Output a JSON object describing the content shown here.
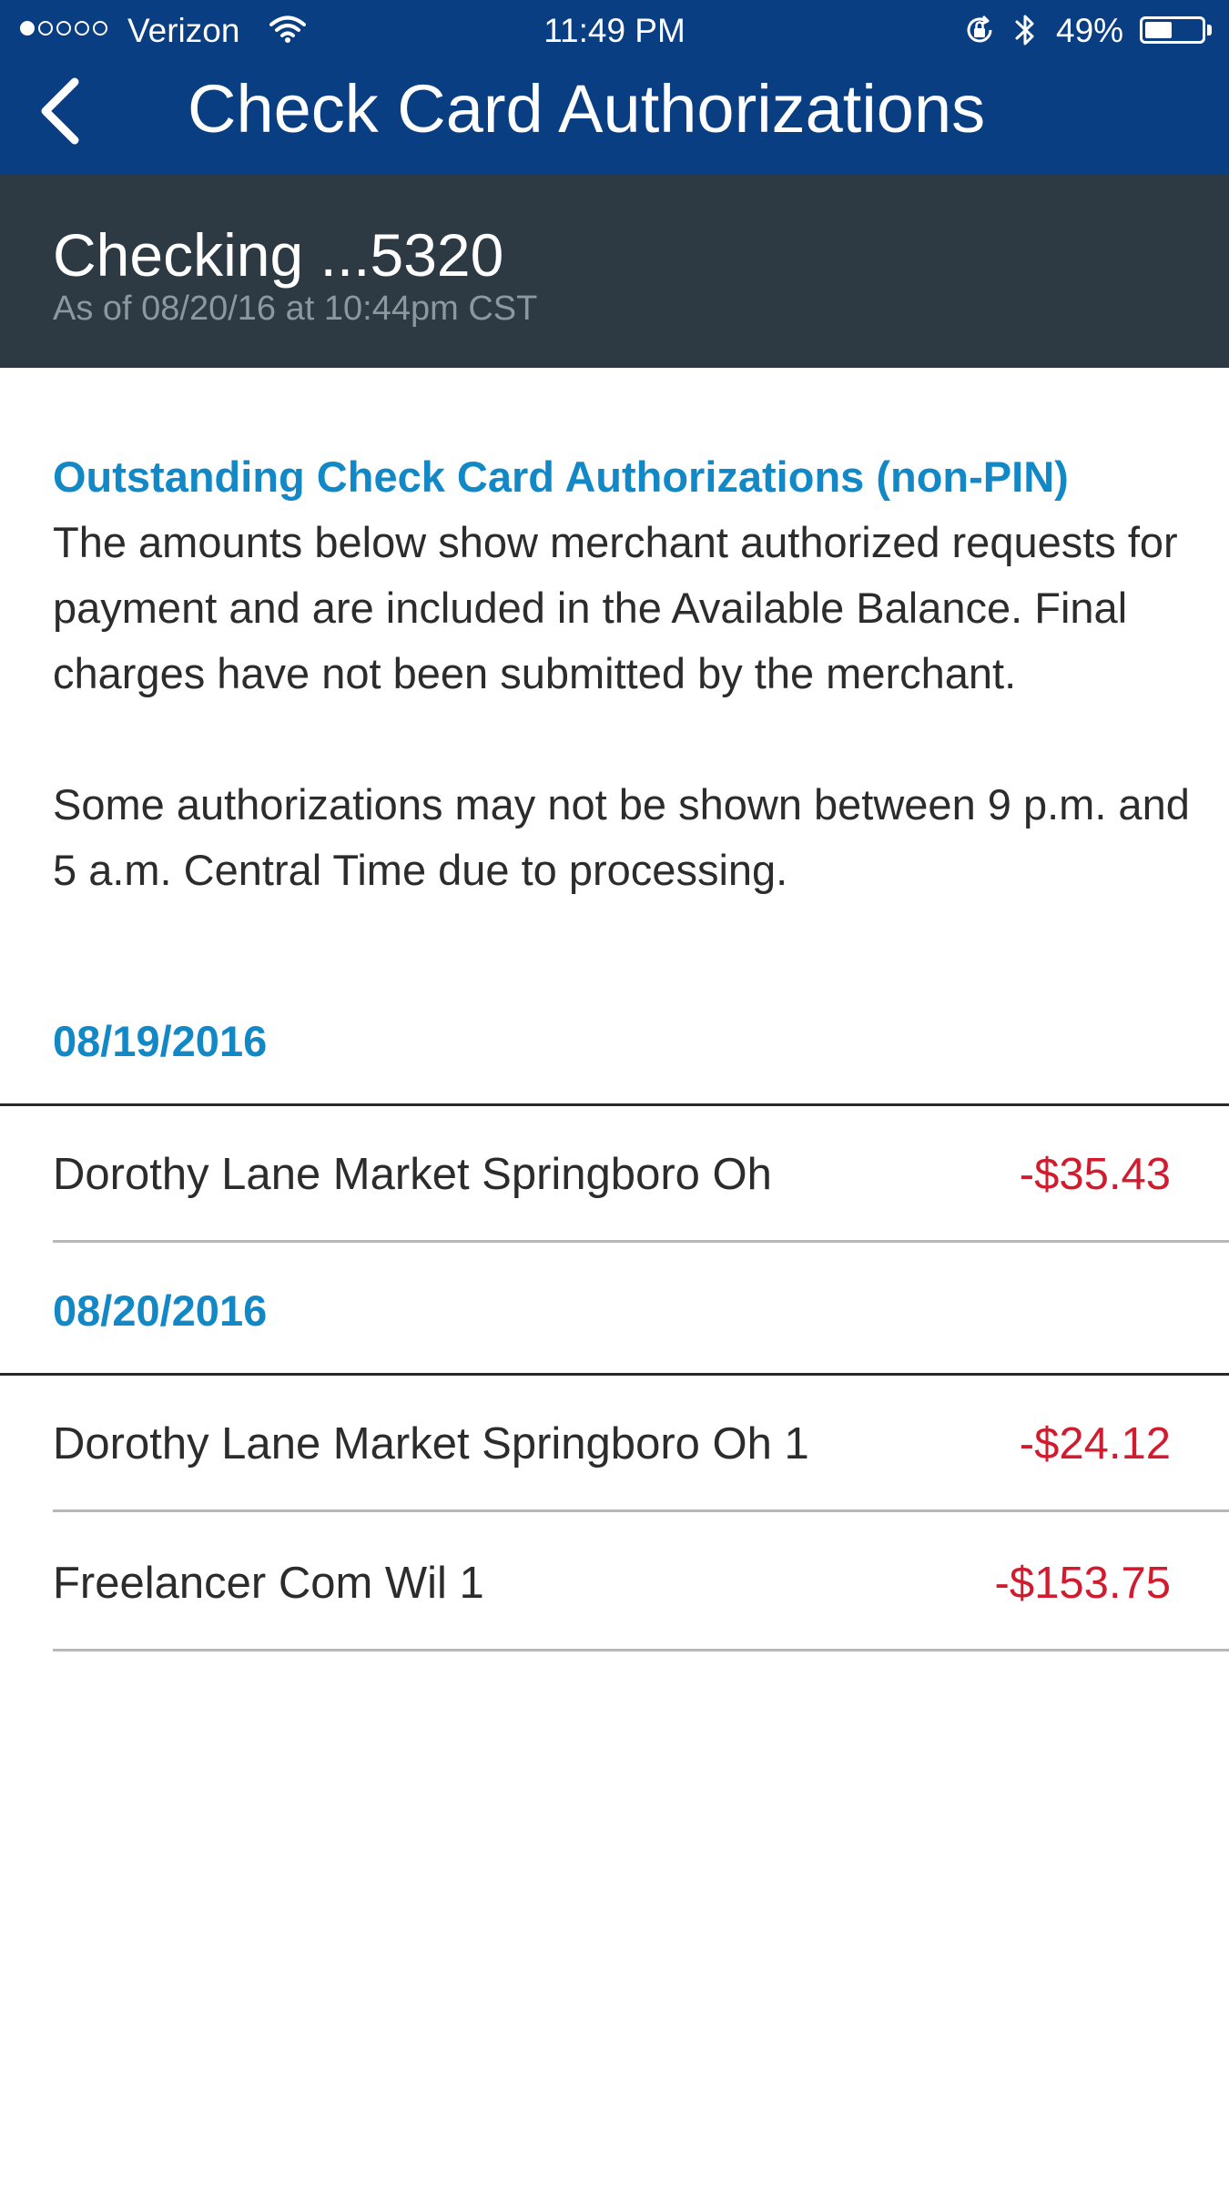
{
  "status_bar": {
    "carrier": "Verizon",
    "time": "11:49 PM",
    "battery_percent": "49%",
    "battery_level": 0.49,
    "signal_bars_filled": 1,
    "signal_bars_total": 5
  },
  "nav": {
    "title": "Check Card Authorizations",
    "back_icon": "chevron-left-icon"
  },
  "account": {
    "name": "Checking ...5320",
    "as_of": "As of 08/20/16 at 10:44pm CST"
  },
  "intro": {
    "heading": "Outstanding Check Card Authorizations (non-PIN)",
    "paragraph1": "The amounts below show merchant authorized requests for payment and are included in the Available Balance. Final charges have not been submitted by the merchant.",
    "paragraph2": "Some authorizations may not be shown between 9 p.m. and 5 a.m. Central Time due to processing."
  },
  "groups": [
    {
      "date": "08/19/2016",
      "transactions": [
        {
          "merchant": "Dorothy Lane Market Springboro Oh",
          "amount": "-$35.43"
        }
      ]
    },
    {
      "date": "08/20/2016",
      "transactions": [
        {
          "merchant": "Dorothy Lane Market Springboro Oh 1",
          "amount": "-$24.12"
        },
        {
          "merchant": "Freelancer Com Wil 1",
          "amount": "-$153.75"
        }
      ]
    }
  ],
  "colors": {
    "nav_bar": "#0a3e82",
    "account_header": "#2d3a43",
    "accent": "#1388c6",
    "negative_amount": "#d01c2e"
  }
}
